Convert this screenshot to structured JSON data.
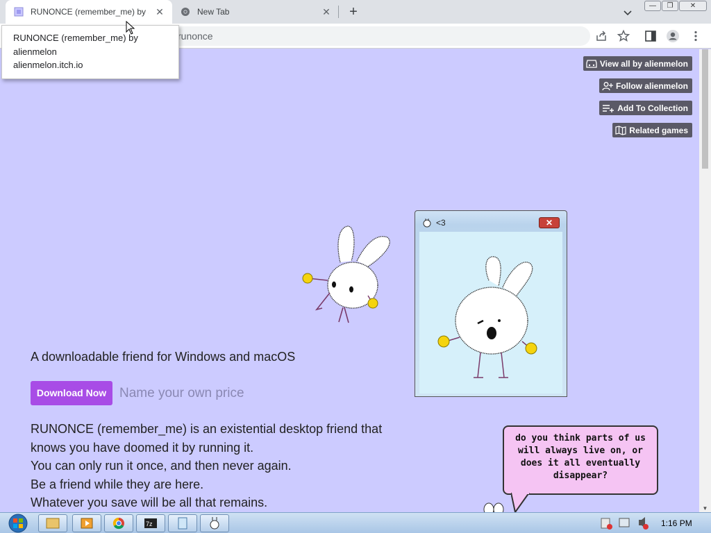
{
  "browser": {
    "tabs": [
      {
        "title": "RUNONCE (remember_me) by alienmelon",
        "active": true
      },
      {
        "title": "New Tab",
        "active": false
      }
    ],
    "address": "runonce",
    "new_tab_symbol": "+",
    "close_symbol": "✕"
  },
  "tooltip": {
    "title": "RUNONCE (remember_me) by alienmelon",
    "domain": "alienmelon.itch.io"
  },
  "itch_buttons": [
    {
      "label": "View all by alienmelon",
      "icon": "gamepad-icon"
    },
    {
      "label": "Follow alienmelon",
      "icon": "user-plus-icon"
    },
    {
      "label": "Add To Collection",
      "icon": "list-add-icon"
    },
    {
      "label": "Related games",
      "icon": "map-icon"
    }
  ],
  "page": {
    "tagline": "A downloadable friend for Windows and macOS",
    "download_label": "Download Now",
    "price_label": "Name your own price",
    "description": [
      "RUNONCE (remember_me) is an existential desktop friend that",
      "knows you have doomed it by running it.",
      "You can only run it once, and then never again.",
      "Be a friend while they are here.",
      "Whatever you save will be all that remains."
    ]
  },
  "game_window": {
    "title": "<3",
    "close_symbol": "✕"
  },
  "speech_bubble": {
    "text": "do you think parts of us will always live on, or does it all eventually disappear?"
  },
  "taskbar": {
    "clock": "1:16 PM"
  },
  "colors": {
    "page_bg": "#cccbff",
    "download_button": "#a84ce6",
    "itch_button": "#5a5966",
    "speech_bg": "#f5c4f3"
  }
}
